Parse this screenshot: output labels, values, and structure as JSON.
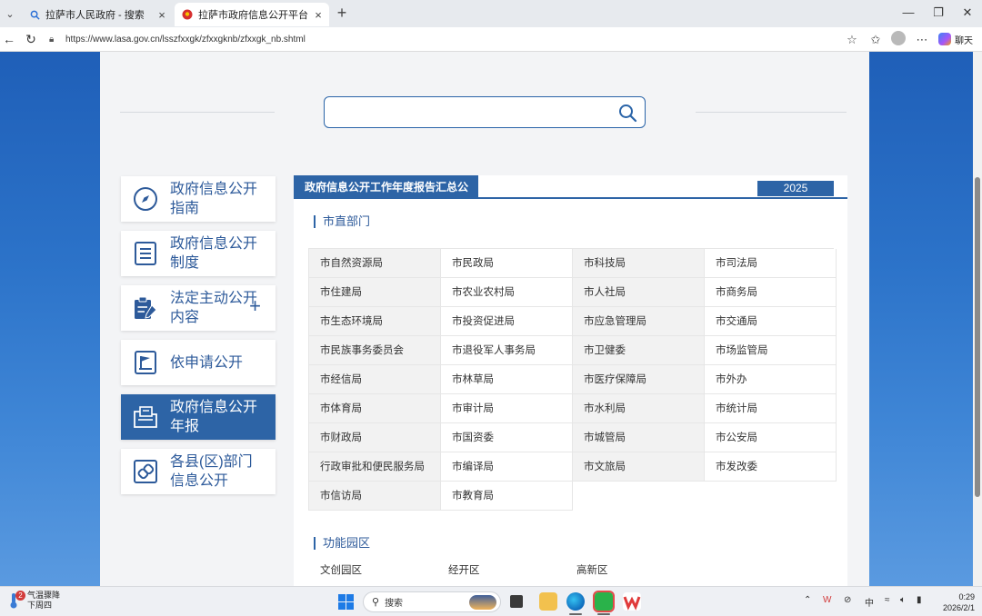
{
  "browser": {
    "tabs": [
      {
        "title": "拉萨市人民政府 - 搜索",
        "active": false
      },
      {
        "title": "拉萨市政府信息公开平台",
        "active": true
      }
    ],
    "url": "https://www.lasa.gov.cn/lsszfxxgk/zfxxgknb/zfxxgk_nb.shtml",
    "chat_label": "聊天"
  },
  "search": {
    "placeholder": ""
  },
  "sidebar": {
    "items": [
      {
        "label": "政府信息公开指南",
        "icon": "compass-icon",
        "active": false
      },
      {
        "label": "政府信息公开制度",
        "icon": "document-list-icon",
        "active": false
      },
      {
        "label": "法定主动公开内容",
        "icon": "clipboard-pen-icon",
        "active": false,
        "expand": "+"
      },
      {
        "label": "依申请公开",
        "icon": "flag-board-icon",
        "active": false
      },
      {
        "label": "政府信息公开年报",
        "icon": "folder-document-icon",
        "active": true
      },
      {
        "label": "各县(区)部门信息公开",
        "icon": "link-icon",
        "active": false
      }
    ]
  },
  "panel": {
    "title": "政府信息公开工作年度报告汇总公布",
    "year": "2025",
    "section1_title": "市直部门",
    "departments": [
      "市自然资源局",
      "市民政局",
      "市科技局",
      "市司法局",
      "市住建局",
      "市农业农村局",
      "市人社局",
      "市商务局",
      "市生态环境局",
      "市投资促进局",
      "市应急管理局",
      "市交通局",
      "市民族事务委员会",
      "市退役军人事务局",
      "市卫健委",
      "市场监管局",
      "市经信局",
      "市林草局",
      "市医疗保障局",
      "市外办",
      "市体育局",
      "市审计局",
      "市水利局",
      "市统计局",
      "市财政局",
      "市国资委",
      "市城管局",
      "市公安局",
      "行政审批和便民服务局",
      "市编译局",
      "市文旅局",
      "市发改委",
      "市信访局",
      "市教育局"
    ],
    "section2_title": "功能园区",
    "parks": [
      "文创园区",
      "经开区",
      "高新区"
    ]
  },
  "taskbar": {
    "weather_line1": "气温骤降",
    "weather_line2": "下周四",
    "weather_badge": "2",
    "search_label": "搜索",
    "ime": "中",
    "time": "0:29",
    "date": "2026/2/1"
  }
}
